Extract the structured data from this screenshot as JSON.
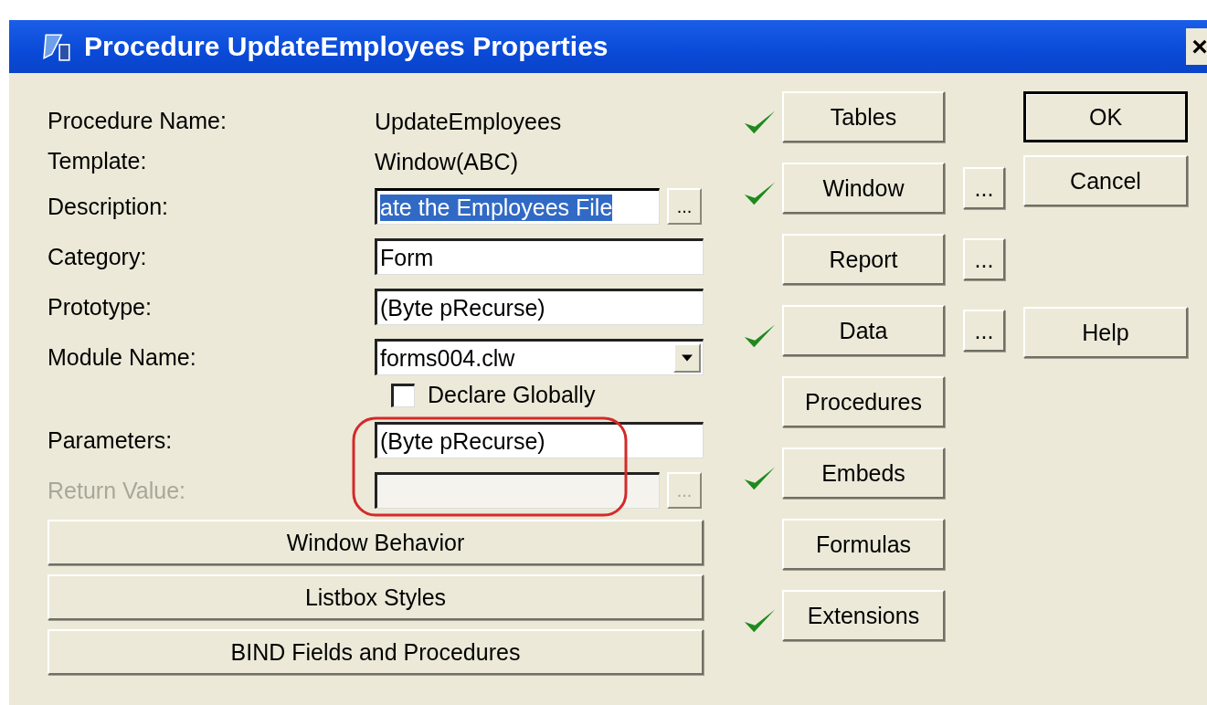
{
  "window": {
    "title": "Procedure UpdateEmployees Properties",
    "close": "×"
  },
  "fields": [
    {
      "kind": "static",
      "label": "Procedure Name:",
      "value": "UpdateEmployees"
    },
    {
      "kind": "static",
      "label": "Template:",
      "value": "Window(ABC)"
    },
    {
      "kind": "text",
      "label": "Description:",
      "value": "ate the Employees File",
      "highlighted": true,
      "more": "...",
      "disabled": false
    },
    {
      "kind": "text",
      "label": "Category:",
      "value": "Form",
      "highlighted": false,
      "disabled": false
    },
    {
      "kind": "text",
      "label": "Prototype:",
      "value": "(Byte pRecurse)",
      "highlighted": false,
      "disabled": false
    },
    {
      "kind": "dropdown",
      "label": "Module Name:",
      "value": "forms004.clw"
    },
    {
      "kind": "checkbox",
      "label": "Declare Globally",
      "checked": false
    },
    {
      "kind": "text",
      "label": "Parameters:",
      "value": "(Byte pRecurse)",
      "highlighted": false,
      "disabled": false
    },
    {
      "kind": "text",
      "label": "Return Value:",
      "highlighted": false,
      "more": "...",
      "disabled": true
    }
  ],
  "wide_buttons": [
    "Window Behavior",
    "Listbox Styles",
    "BIND Fields and Procedures"
  ],
  "sections": [
    {
      "label": "Tables",
      "checked": true
    },
    {
      "label": "Window",
      "checked": true,
      "more": "..."
    },
    {
      "label": "Report",
      "checked": false,
      "more": "..."
    },
    {
      "label": "Data",
      "checked": true,
      "more": "..."
    },
    {
      "label": "Procedures",
      "checked": false
    },
    {
      "label": "Embeds",
      "checked": true
    },
    {
      "label": "Formulas",
      "checked": false
    },
    {
      "label": "Extensions",
      "checked": true
    }
  ],
  "dialog_buttons": [
    {
      "label": "OK",
      "default": true
    },
    {
      "label": "Cancel",
      "default": false
    },
    {
      "label": "Help",
      "default": false
    }
  ]
}
